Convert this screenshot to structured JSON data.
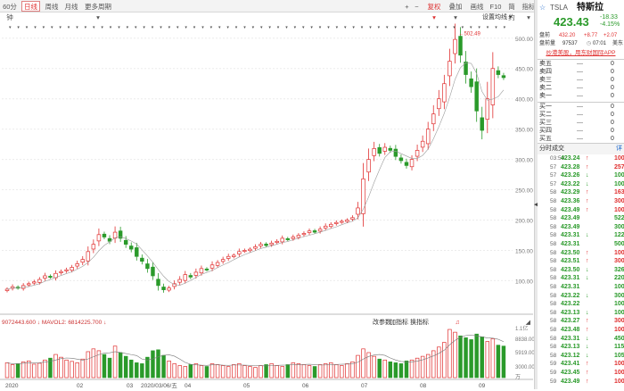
{
  "toolbar": {
    "tabs": [
      {
        "label": "60分钟"
      },
      {
        "label": "日线",
        "active": true
      },
      {
        "label": "周线"
      },
      {
        "label": "月线"
      },
      {
        "label": "更多周期 ▾"
      }
    ],
    "right": [
      {
        "label": "+"
      },
      {
        "label": "−"
      },
      {
        "label": "复权 ▾",
        "red": true
      },
      {
        "label": "叠加 ▾"
      },
      {
        "label": "画线"
      },
      {
        "label": "F10"
      },
      {
        "label": "简约"
      },
      {
        "label": "指标 ▾"
      }
    ]
  },
  "chart": {
    "settings_label": "设置均线 ▾",
    "price_ticks": [
      "500.00",
      "450.00",
      "400.00",
      "350.00",
      "300.00",
      "250.00",
      "200.00",
      "150.00",
      "100.00",
      "50.00"
    ],
    "peak_label": "502.49",
    "vol_label_left": "9072443.600 ↓  MAVOL2: 6814225.700 ↓",
    "vol_buttons": [
      "改参数",
      "加指标",
      "换指标"
    ],
    "vol_ticks": [
      "1.1亿",
      "8838.00",
      "5919.00",
      "3000.00",
      "万"
    ],
    "x_labels": [
      "2020",
      "02",
      "03",
      "2020/03/06/五",
      "04",
      "05",
      "06",
      "07",
      "08",
      "09"
    ],
    "colors": {
      "up": "#e03030",
      "down": "#2a9a2a",
      "ma": "#7a7a7a"
    }
  },
  "chart_data": {
    "type": "candlestick",
    "ylim": [
      0,
      510
    ],
    "closes": [
      86,
      90,
      88,
      92,
      95,
      98,
      102,
      108,
      106,
      112,
      115,
      118,
      122,
      128,
      135,
      148,
      160,
      176,
      172,
      165,
      180,
      170,
      160,
      152,
      140,
      132,
      120,
      108,
      92,
      85,
      88,
      95,
      102,
      110,
      106,
      114,
      120,
      118,
      126,
      130,
      135,
      140,
      142,
      148,
      150,
      152,
      156,
      160,
      158,
      162,
      165,
      170,
      168,
      172,
      175,
      178,
      182,
      180,
      185,
      190,
      193,
      196,
      198,
      200,
      204,
      220,
      268,
      300,
      318,
      310,
      320,
      315,
      305,
      298,
      290,
      300,
      315,
      330,
      350,
      375,
      400,
      425,
      462,
      498,
      472,
      440,
      420,
      380,
      348,
      400,
      450,
      440,
      435
    ],
    "volumes": [
      3.2,
      2.8,
      3.0,
      3.4,
      3.6,
      2.9,
      3.1,
      3.8,
      4.2,
      5.0,
      4.4,
      3.8,
      3.5,
      3.2,
      4.0,
      5.6,
      6.2,
      5.8,
      5.0,
      4.2,
      6.8,
      5.4,
      4.6,
      3.8,
      3.2,
      3.0,
      4.4,
      5.8,
      6.0,
      4.8,
      3.6,
      3.0,
      2.6,
      2.4,
      2.8,
      3.0,
      2.6,
      2.4,
      3.0,
      2.8,
      2.6,
      2.4,
      2.8,
      3.0,
      2.6,
      2.4,
      2.2,
      2.6,
      2.8,
      3.0,
      2.6,
      2.4,
      2.8,
      3.2,
      3.0,
      2.8,
      2.6,
      2.4,
      2.8,
      3.0,
      3.2,
      2.8,
      2.6,
      3.0,
      3.4,
      4.8,
      6.2,
      5.4,
      4.6,
      4.0,
      3.8,
      3.4,
      3.2,
      3.0,
      3.6,
      3.8,
      4.2,
      4.6,
      5.0,
      5.8,
      6.6,
      7.6,
      10.4,
      9.8,
      9.0,
      8.6,
      8.2,
      9.4,
      8.8,
      7.8,
      8.4,
      7.0,
      6.8
    ]
  },
  "panel": {
    "ticker": "TSLA",
    "name": "特斯拉",
    "price": "423.43",
    "change": "-18.33",
    "change_pct": "-4.15%",
    "pre_label": "盘前",
    "pre_price": "432.20",
    "pre_change": "+8.77",
    "pre_pct": "+2.07",
    "pre_vol_label": "盘前量",
    "pre_vol": "97537",
    "pre_time": "07:01",
    "pre_tz": "美东",
    "promo": "炒港美股，用东财国际APP",
    "asks": [
      {
        "label": "卖五",
        "price": "—",
        "vol": "0"
      },
      {
        "label": "卖四",
        "price": "—",
        "vol": "0"
      },
      {
        "label": "卖三",
        "price": "—",
        "vol": "0"
      },
      {
        "label": "卖二",
        "price": "—",
        "vol": "0"
      },
      {
        "label": "卖一",
        "price": "—",
        "vol": "0"
      }
    ],
    "bids": [
      {
        "label": "买一",
        "price": "—",
        "vol": "0"
      },
      {
        "label": "买二",
        "price": "—",
        "vol": "0"
      },
      {
        "label": "买三",
        "price": "—",
        "vol": "0"
      },
      {
        "label": "买四",
        "price": "—",
        "vol": "0"
      },
      {
        "label": "买五",
        "price": "—",
        "vol": "0"
      }
    ],
    "trades_title": "分时成交",
    "trades_more": "详",
    "trades": [
      {
        "time": "03:59",
        "price": "423.24",
        "dir": "up",
        "vol": "100"
      },
      {
        "time": "57",
        "price": "423.28",
        "dir": "up",
        "vol": "257"
      },
      {
        "time": "57",
        "price": "423.26",
        "dir": "down",
        "vol": "100"
      },
      {
        "time": "57",
        "price": "423.22",
        "dir": "down",
        "vol": "100"
      },
      {
        "time": "58",
        "price": "423.29",
        "dir": "up",
        "vol": "163"
      },
      {
        "time": "58",
        "price": "423.36",
        "dir": "up",
        "vol": "300"
      },
      {
        "time": "58",
        "price": "423.49",
        "dir": "up",
        "vol": "100"
      },
      {
        "time": "58",
        "price": "423.49",
        "dir": "",
        "vol": "522"
      },
      {
        "time": "58",
        "price": "423.49",
        "dir": "",
        "vol": "300"
      },
      {
        "time": "58",
        "price": "423.31",
        "dir": "down",
        "vol": "122"
      },
      {
        "time": "58",
        "price": "423.31",
        "dir": "",
        "vol": "500"
      },
      {
        "time": "58",
        "price": "423.50",
        "dir": "up",
        "vol": "100"
      },
      {
        "time": "58",
        "price": "423.51",
        "dir": "up",
        "vol": "300"
      },
      {
        "time": "58",
        "price": "423.50",
        "dir": "down",
        "vol": "326"
      },
      {
        "time": "58",
        "price": "423.31",
        "dir": "down",
        "vol": "220"
      },
      {
        "time": "58",
        "price": "423.31",
        "dir": "",
        "vol": "100"
      },
      {
        "time": "58",
        "price": "423.22",
        "dir": "down",
        "vol": "300"
      },
      {
        "time": "58",
        "price": "423.22",
        "dir": "",
        "vol": "100"
      },
      {
        "time": "58",
        "price": "423.13",
        "dir": "down",
        "vol": "100"
      },
      {
        "time": "58",
        "price": "423.27",
        "dir": "up",
        "vol": "300"
      },
      {
        "time": "58",
        "price": "423.48",
        "dir": "up",
        "vol": "100"
      },
      {
        "time": "58",
        "price": "423.31",
        "dir": "down",
        "vol": "450"
      },
      {
        "time": "58",
        "price": "423.13",
        "dir": "down",
        "vol": "115"
      },
      {
        "time": "58",
        "price": "423.12",
        "dir": "down",
        "vol": "1059"
      },
      {
        "time": "59",
        "price": "423.41",
        "dir": "up",
        "vol": "100"
      },
      {
        "time": "59",
        "price": "423.45",
        "dir": "up",
        "vol": "100"
      },
      {
        "time": "59",
        "price": "423.49",
        "dir": "up",
        "vol": "100"
      }
    ]
  }
}
